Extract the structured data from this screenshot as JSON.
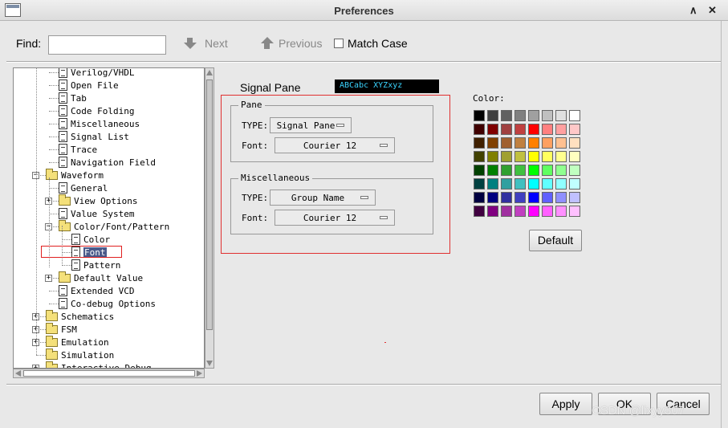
{
  "window": {
    "title": "Preferences"
  },
  "find": {
    "label": "Find:",
    "value": "",
    "next_label": "Next",
    "previous_label": "Previous",
    "match_case_label": "Match Case"
  },
  "tree": {
    "items": [
      {
        "label": "Verilog/VHDL",
        "type": "doc",
        "selected": false
      },
      {
        "label": "Open File",
        "type": "doc",
        "selected": false
      },
      {
        "label": "Tab",
        "type": "doc",
        "selected": false
      },
      {
        "label": "Code Folding",
        "type": "doc",
        "selected": false
      },
      {
        "label": "Miscellaneous",
        "type": "doc",
        "selected": false
      },
      {
        "label": "Signal List",
        "type": "doc",
        "selected": false
      },
      {
        "label": "Trace",
        "type": "doc",
        "selected": false
      },
      {
        "label": "Navigation Field",
        "type": "doc",
        "selected": false
      },
      {
        "label": "Waveform",
        "type": "folder",
        "expander": "−",
        "selected": false
      },
      {
        "label": "General",
        "type": "doc",
        "selected": false
      },
      {
        "label": "View Options",
        "type": "folder",
        "expander": "+",
        "selected": false
      },
      {
        "label": "Value System",
        "type": "doc",
        "selected": false
      },
      {
        "label": "Color/Font/Pattern",
        "type": "folder",
        "expander": "−",
        "selected": false
      },
      {
        "label": "Color",
        "type": "doc",
        "selected": false
      },
      {
        "label": "Font",
        "type": "doc",
        "selected": true
      },
      {
        "label": "Pattern",
        "type": "doc",
        "selected": false
      },
      {
        "label": "Default Value",
        "type": "folder",
        "expander": "+",
        "selected": false
      },
      {
        "label": "Extended VCD",
        "type": "doc",
        "selected": false
      },
      {
        "label": "Co-debug Options",
        "type": "doc",
        "selected": false
      },
      {
        "label": "Schematics",
        "type": "folder",
        "expander": "+",
        "selected": false
      },
      {
        "label": "FSM",
        "type": "folder",
        "expander": "+",
        "selected": false
      },
      {
        "label": "Emulation",
        "type": "folder",
        "expander": "+",
        "selected": false
      },
      {
        "label": "Simulation",
        "type": "folder",
        "expander": "",
        "selected": false
      },
      {
        "label": "Interactive Debug",
        "type": "folder",
        "expander": "+",
        "selected": false
      }
    ]
  },
  "signal_pane": {
    "title": "Signal Pane",
    "preview_text": "ABCabc XYZxyz",
    "pane_group": {
      "title": "Pane",
      "type_label": "TYPE:",
      "type_value": "Signal Pane",
      "font_label": "Font:",
      "font_value": "Courier 12"
    },
    "misc_group": {
      "title": "Miscellaneous",
      "type_label": "TYPE:",
      "type_value": "Group Name",
      "font_label": "Font:",
      "font_value": "Courier 12"
    }
  },
  "color": {
    "label": "Color:",
    "default_button": "Default",
    "swatches": [
      [
        "#000000",
        "#404040",
        "#606060",
        "#808080",
        "#a0a0a0",
        "#c0c0c0",
        "#e0e0e0",
        "#ffffff"
      ],
      [
        "#400000",
        "#800000",
        "#a04040",
        "#c04040",
        "#ff0000",
        "#ff8080",
        "#ffa0a0",
        "#ffc8c8"
      ],
      [
        "#402000",
        "#804000",
        "#a06030",
        "#c08040",
        "#ff8000",
        "#ffa060",
        "#ffc090",
        "#ffe0c0"
      ],
      [
        "#404000",
        "#808000",
        "#a0a030",
        "#c0c040",
        "#ffff00",
        "#ffff60",
        "#ffff90",
        "#ffffc0"
      ],
      [
        "#004000",
        "#008000",
        "#30a030",
        "#40c040",
        "#00ff00",
        "#60ff60",
        "#90ff90",
        "#c0ffc0"
      ],
      [
        "#004040",
        "#008080",
        "#30a0a0",
        "#40c0c0",
        "#00ffff",
        "#60ffff",
        "#90ffff",
        "#c0ffff"
      ],
      [
        "#000040",
        "#000080",
        "#3030a0",
        "#4040c0",
        "#0000ff",
        "#6060ff",
        "#9090ff",
        "#c0c0ff"
      ],
      [
        "#400040",
        "#800080",
        "#a030a0",
        "#c040c0",
        "#ff00ff",
        "#ff60ff",
        "#ff90ff",
        "#ffc0ff"
      ]
    ]
  },
  "footer": {
    "apply_label": "Apply",
    "ok_label": "OK",
    "cancel_label": "Cancel"
  },
  "watermark": "CSDN @lixyy307"
}
